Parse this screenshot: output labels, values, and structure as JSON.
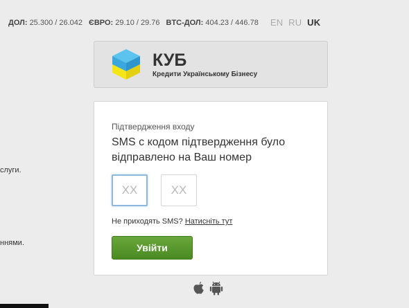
{
  "currency": {
    "usd": {
      "label": "ДОЛ:",
      "value": "25.300 / 26.042"
    },
    "eur": {
      "label": "ЄВРО:",
      "value": "29.10 / 29.76"
    },
    "btc": {
      "label": "BTC-ДОЛ:",
      "value": "404.23 / 446.78"
    }
  },
  "languages": [
    {
      "code": "EN",
      "active": false
    },
    {
      "code": "RU",
      "active": false
    },
    {
      "code": "UK",
      "active": true
    }
  ],
  "side_texts": [
    "слуги.",
    "ннями."
  ],
  "logo": {
    "name": "КУБ",
    "subtitle": "Кредити Українському Бізнесу",
    "icon": "cube-logo-icon",
    "colors": {
      "top": "#4fb8e8",
      "bottom": "#f2e21c"
    }
  },
  "confirm": {
    "label": "Підтвердження входу",
    "message": "SMS с кодом підтвердження було відправлено на Ваш номер",
    "code1_placeholder": "XX",
    "code2_placeholder": "XX",
    "resend_question": "Не приходять SMS?",
    "resend_link": "Натисніть тут",
    "submit_label": "Увійти"
  },
  "apps": [
    {
      "icon": "apple-icon"
    },
    {
      "icon": "android-icon"
    }
  ],
  "colors": {
    "accent_green": "#4a8a22",
    "focus_blue": "#8fb8de",
    "background": "#ececec"
  }
}
